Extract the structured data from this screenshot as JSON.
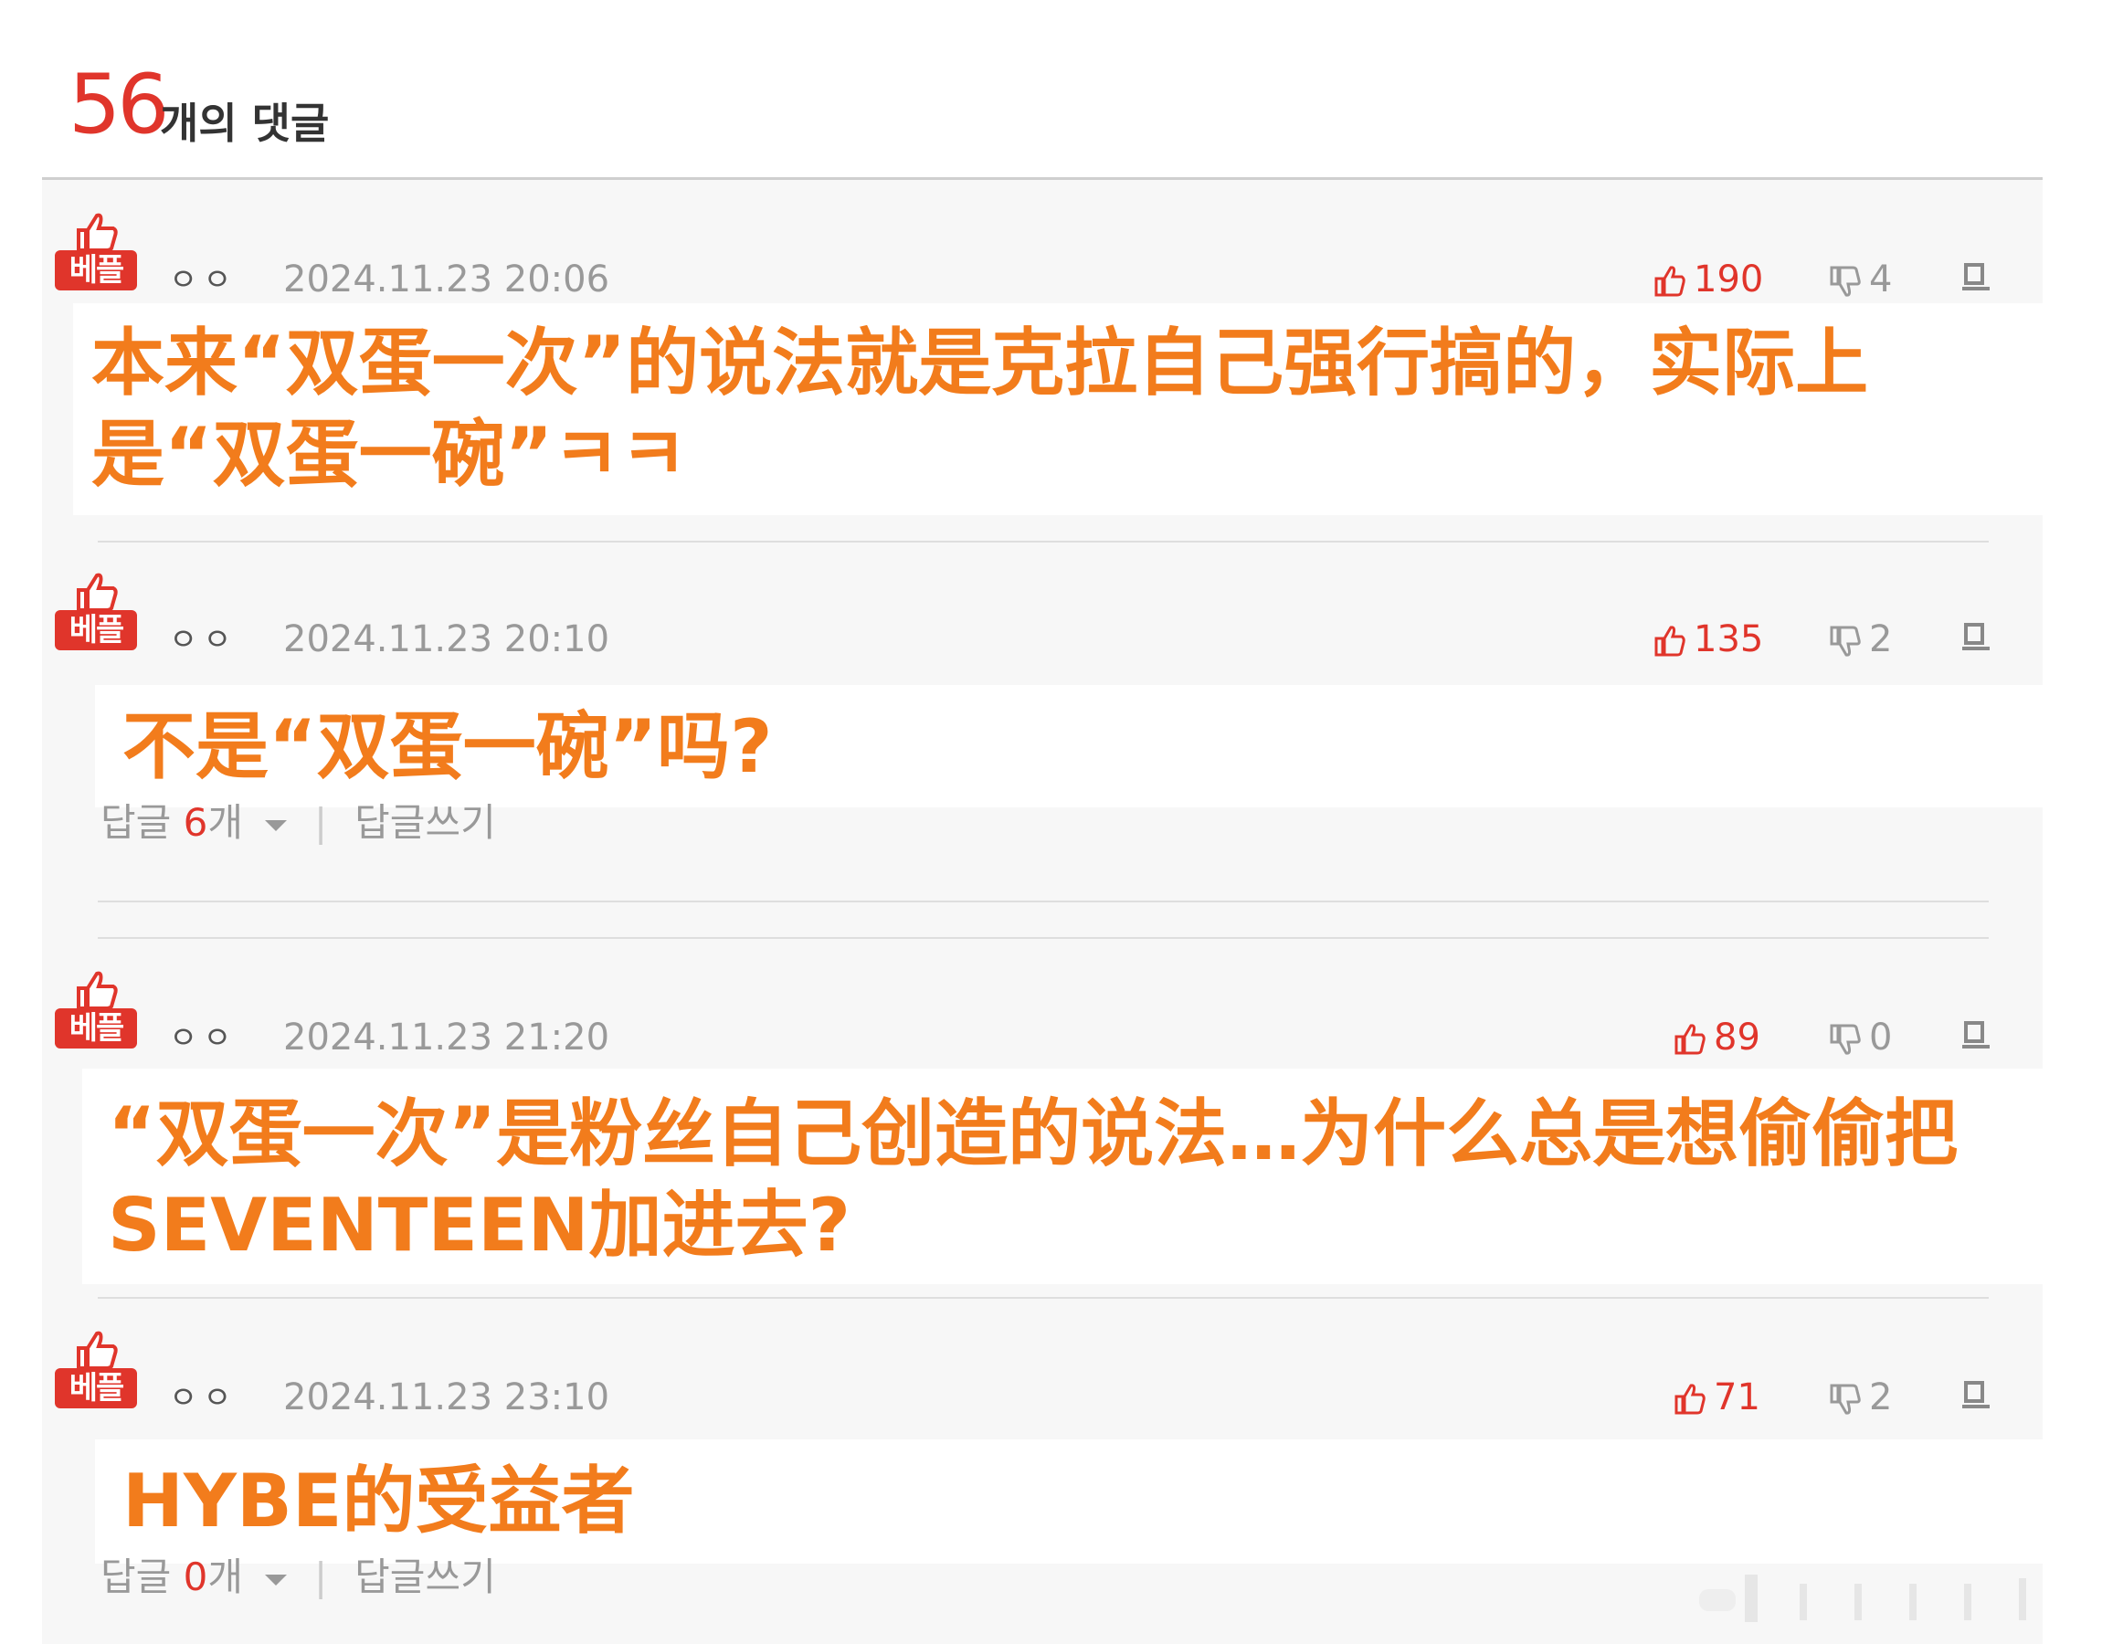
{
  "header": {
    "count": "56",
    "count_label": "개의 댓글"
  },
  "comments": [
    {
      "badge": "베플",
      "nick": "ㅇㅇ",
      "date": "2024.11.23 20:06",
      "up": "190",
      "down": "4",
      "text": "本来“双蛋一次”的说法就是克拉自己强行搞的，实际上是“双蛋一碗”ㅋㅋ"
    },
    {
      "badge": "베플",
      "nick": "ㅇㅇ",
      "date": "2024.11.23 20:10",
      "up": "135",
      "down": "2",
      "text": "不是“双蛋一碗”吗?",
      "reply_label": "답글",
      "reply_count": "6",
      "reply_unit": "개",
      "write_reply": "답글쓰기"
    },
    {
      "badge": "베플",
      "nick": "ㅇㅇ",
      "date": "2024.11.23 21:20",
      "up": "89",
      "down": "0",
      "text": "“双蛋一次”是粉丝自己创造的说法…为什么总是想偷偷把SEVENTEEN加进去?"
    },
    {
      "badge": "베플",
      "nick": "ㅇㅇ",
      "date": "2024.11.23 23:10",
      "up": "71",
      "down": "2",
      "text": "HYBE的受益者",
      "reply_label": "답글",
      "reply_count": "0",
      "reply_unit": "개",
      "write_reply": "답글쓰기"
    }
  ],
  "colors": {
    "accent_red": "#e0352b",
    "overlay_orange": "#f27c1c",
    "muted_gray": "#999999"
  },
  "icons": [
    "thumbs-up-icon",
    "thumbs-down-icon",
    "report-icon",
    "caret-down-icon"
  ]
}
